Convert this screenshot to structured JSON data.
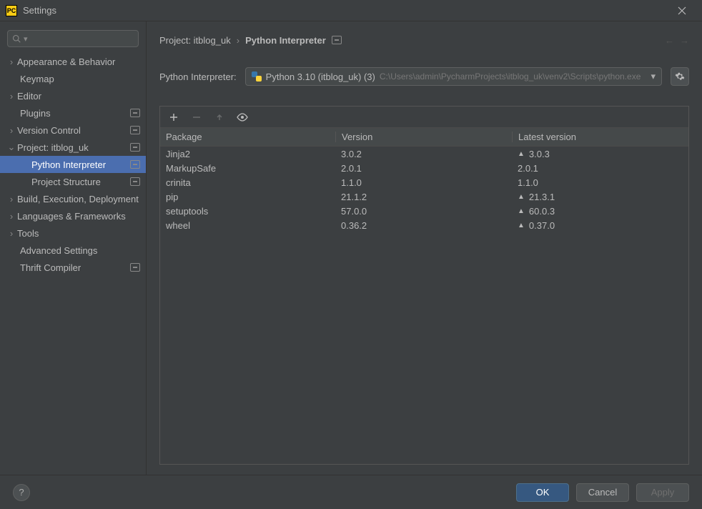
{
  "window": {
    "title": "Settings"
  },
  "sidebar": {
    "search_placeholder": "",
    "items": [
      {
        "label": "Appearance & Behavior",
        "chevron": "right",
        "indent": 0,
        "badge": false,
        "selected": false
      },
      {
        "label": "Keymap",
        "chevron": "",
        "indent": 1,
        "badge": false,
        "selected": false
      },
      {
        "label": "Editor",
        "chevron": "right",
        "indent": 0,
        "badge": false,
        "selected": false
      },
      {
        "label": "Plugins",
        "chevron": "",
        "indent": 1,
        "badge": true,
        "selected": false
      },
      {
        "label": "Version Control",
        "chevron": "right",
        "indent": 0,
        "badge": true,
        "selected": false
      },
      {
        "label": "Project: itblog_uk",
        "chevron": "down",
        "indent": 0,
        "badge": true,
        "selected": false
      },
      {
        "label": "Python Interpreter",
        "chevron": "",
        "indent": 2,
        "badge": true,
        "selected": true
      },
      {
        "label": "Project Structure",
        "chevron": "",
        "indent": 2,
        "badge": true,
        "selected": false
      },
      {
        "label": "Build, Execution, Deployment",
        "chevron": "right",
        "indent": 0,
        "badge": false,
        "selected": false
      },
      {
        "label": "Languages & Frameworks",
        "chevron": "right",
        "indent": 0,
        "badge": false,
        "selected": false
      },
      {
        "label": "Tools",
        "chevron": "right",
        "indent": 0,
        "badge": false,
        "selected": false
      },
      {
        "label": "Advanced Settings",
        "chevron": "",
        "indent": 1,
        "badge": false,
        "selected": false
      },
      {
        "label": "Thrift Compiler",
        "chevron": "",
        "indent": 1,
        "badge": true,
        "selected": false
      }
    ]
  },
  "breadcrumb": {
    "project": "Project: itblog_uk",
    "page": "Python Interpreter"
  },
  "interpreter": {
    "label": "Python Interpreter:",
    "name": "Python 3.10 (itblog_uk) (3)",
    "path": "C:\\Users\\admin\\PycharmProjects\\itblog_uk\\venv2\\Scripts\\python.exe"
  },
  "packages": {
    "headers": {
      "package": "Package",
      "version": "Version",
      "latest": "Latest version"
    },
    "rows": [
      {
        "name": "Jinja2",
        "version": "3.0.2",
        "latest": "3.0.3",
        "upgrade": true
      },
      {
        "name": "MarkupSafe",
        "version": "2.0.1",
        "latest": "2.0.1",
        "upgrade": false
      },
      {
        "name": "crinita",
        "version": "1.1.0",
        "latest": "1.1.0",
        "upgrade": false
      },
      {
        "name": "pip",
        "version": "21.1.2",
        "latest": "21.3.1",
        "upgrade": true
      },
      {
        "name": "setuptools",
        "version": "57.0.0",
        "latest": "60.0.3",
        "upgrade": true
      },
      {
        "name": "wheel",
        "version": "0.36.2",
        "latest": "0.37.0",
        "upgrade": true
      }
    ]
  },
  "buttons": {
    "ok": "OK",
    "cancel": "Cancel",
    "apply": "Apply"
  }
}
